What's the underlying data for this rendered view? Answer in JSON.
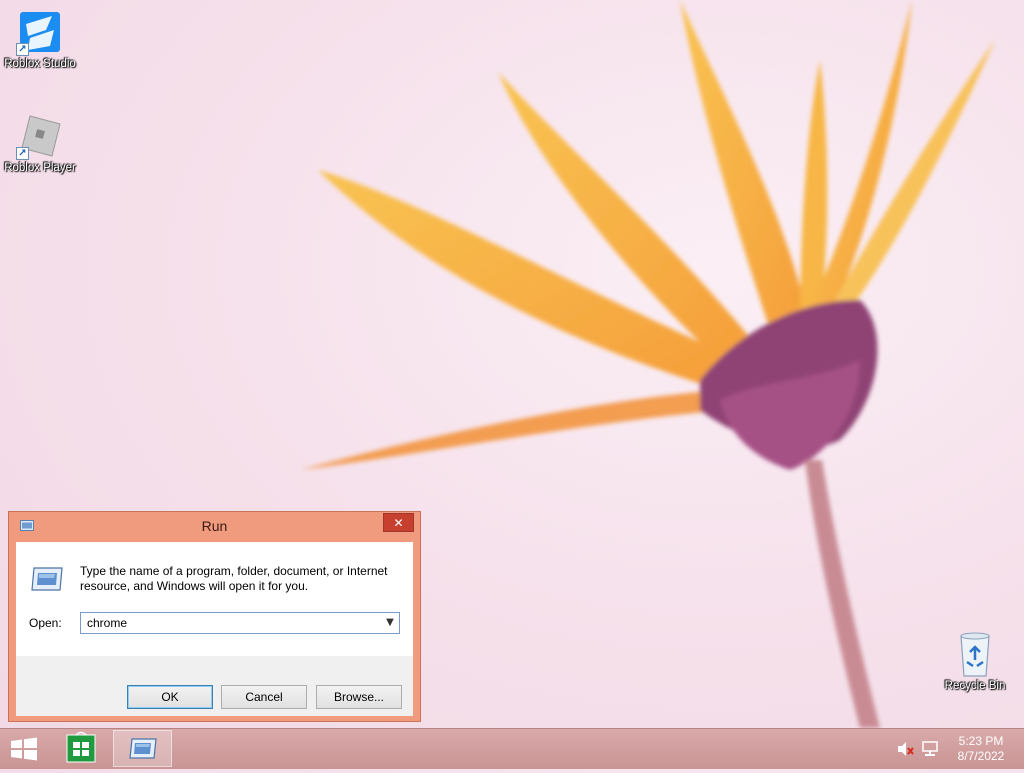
{
  "desktop": {
    "icons": [
      {
        "label": "Roblox Studio",
        "icon": "roblox-studio-icon"
      },
      {
        "label": "Roblox Player",
        "icon": "roblox-player-icon"
      },
      {
        "label": "Recycle Bin",
        "icon": "recycle-bin-icon"
      }
    ]
  },
  "run_dialog": {
    "title": "Run",
    "close_glyph": "✕",
    "description": "Type the name of a program, folder, document, or Internet resource, and Windows will open it for you.",
    "open_label": "Open:",
    "open_value": "chrome",
    "buttons": {
      "ok": "OK",
      "cancel": "Cancel",
      "browse": "Browse..."
    }
  },
  "taskbar": {
    "clock": {
      "time": "5:23 PM",
      "date": "8/7/2022"
    },
    "apps": [
      "start",
      "store",
      "run"
    ]
  },
  "colors": {
    "dialog_frame": "#f09a7e",
    "close_button": "#c7402f",
    "taskbar": "#d0a0a0",
    "wallpaper": "#f6e2ec"
  }
}
